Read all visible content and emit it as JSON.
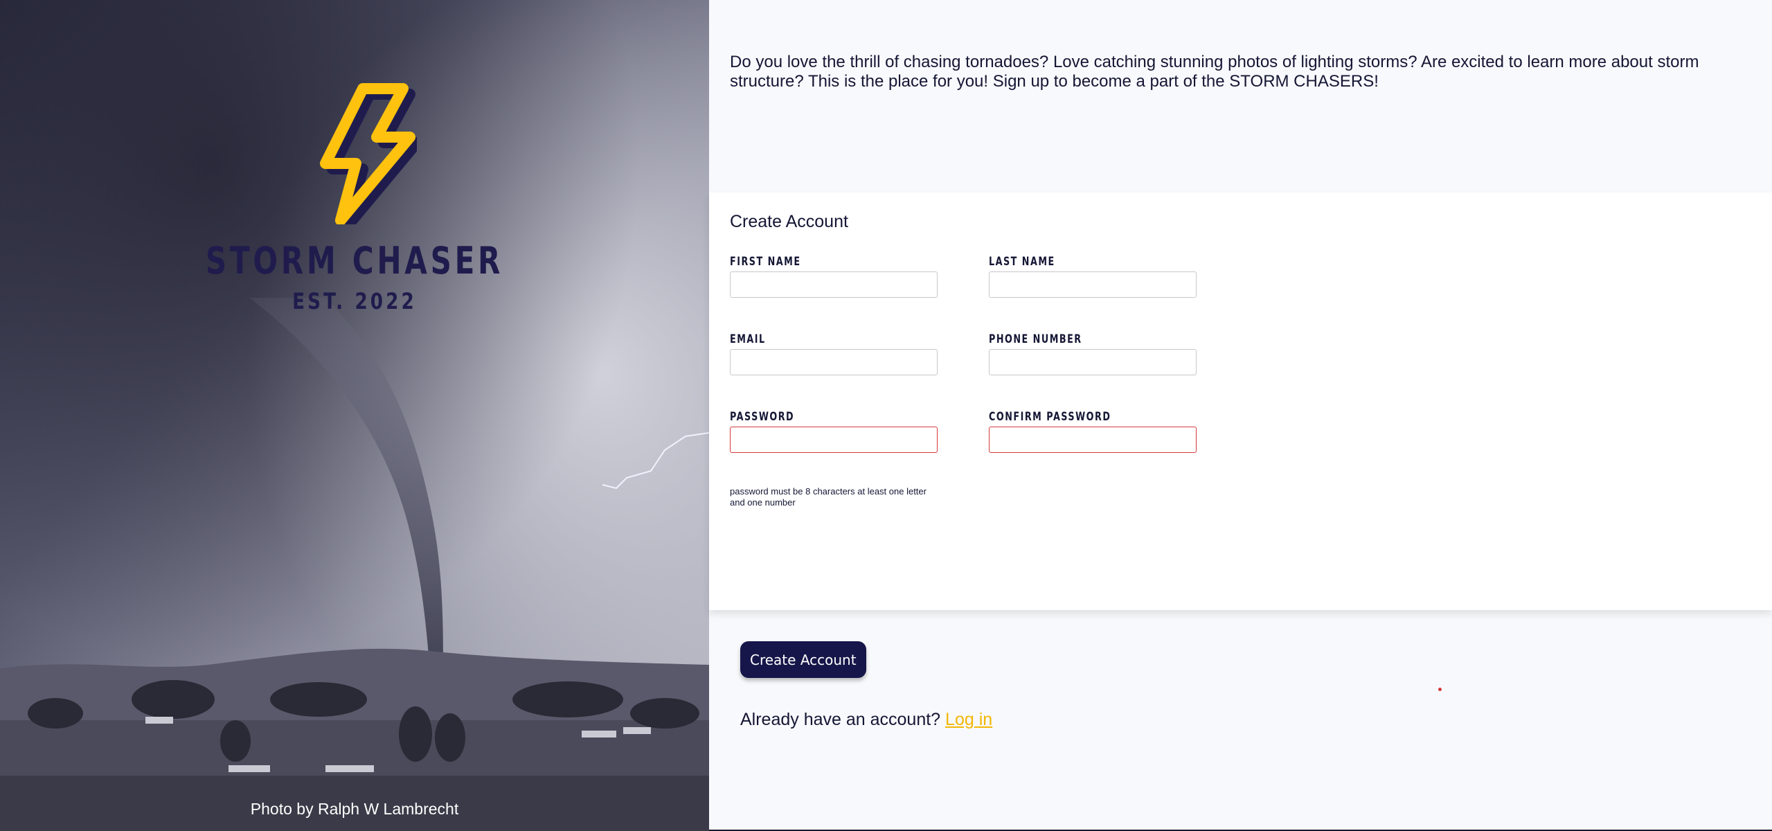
{
  "brand": {
    "name": "STORM CHASER",
    "est": "EST. 2022",
    "logo_icon": "lightning-bolt-icon",
    "accent_color": "#ffc20e",
    "navy_color": "#1f1c4d"
  },
  "hero": {
    "photo_credit": "Photo by Ralph W Lambrecht"
  },
  "intro": {
    "text": "Do you love the thrill of chasing tornadoes? Love catching stunning photos of lighting storms? Are excited to learn more about storm structure? This is the place for you! Sign up to become a part of the STORM CHASERS!"
  },
  "form": {
    "title": "Create Account",
    "first_name": {
      "label": "FIRST NAME",
      "value": ""
    },
    "last_name": {
      "label": "LAST NAME",
      "value": ""
    },
    "email": {
      "label": "EMAIL",
      "value": ""
    },
    "phone": {
      "label": "PHONE NUMBER",
      "value": ""
    },
    "password": {
      "label": "PASSWORD",
      "value": ""
    },
    "confirm_password": {
      "label": "CONFIRM PASSWORD",
      "value": ""
    },
    "password_hint": "password must be 8 characters at least one letter and one number",
    "error_color": "#d33a3a"
  },
  "actions": {
    "create_button": "Create Account",
    "already_text": "Already have an account?",
    "login_link": "Log in"
  }
}
